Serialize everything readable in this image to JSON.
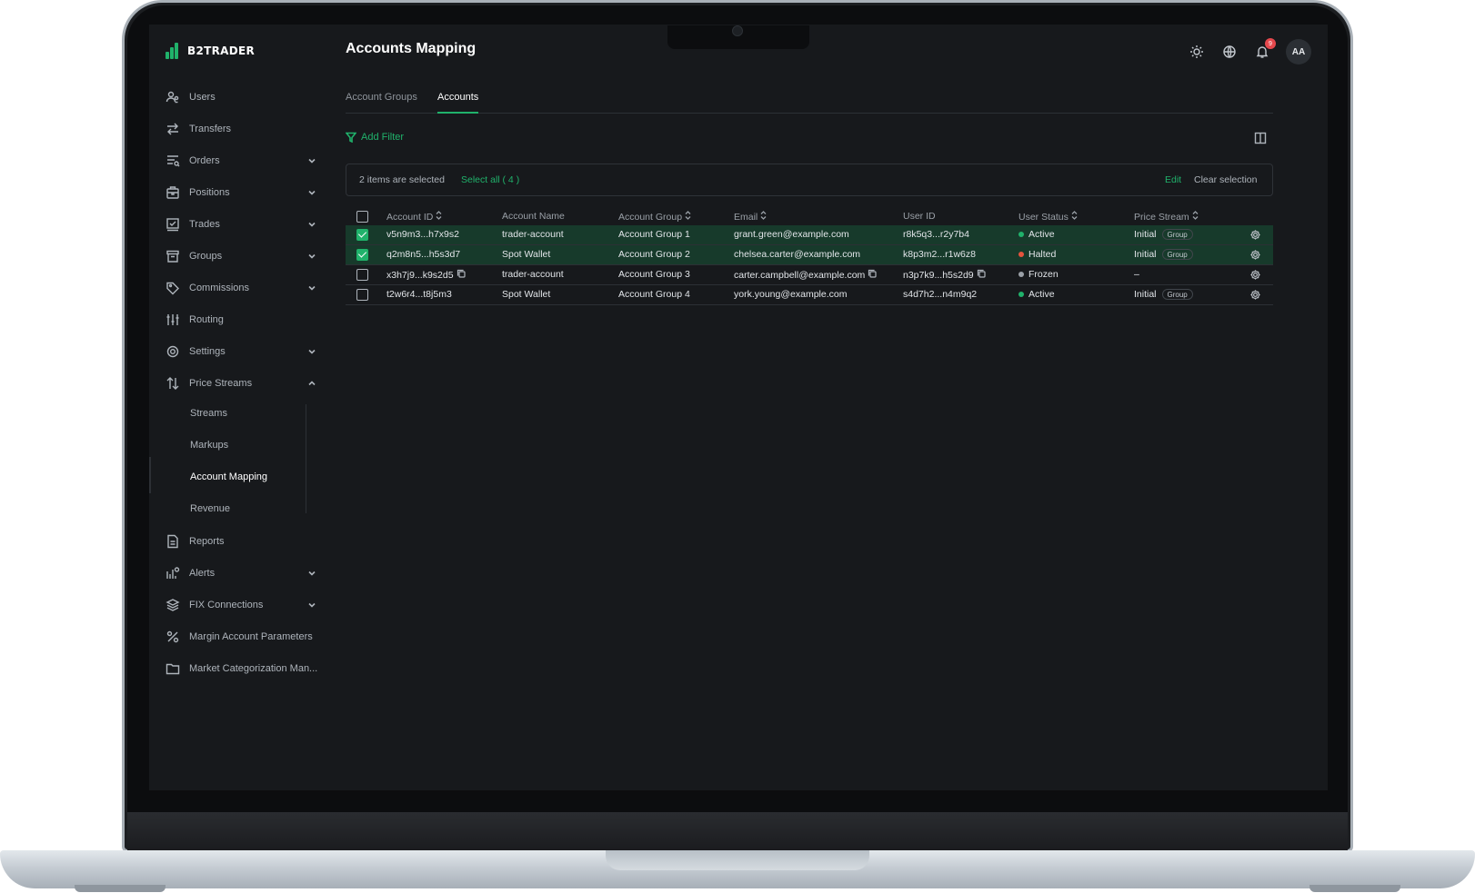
{
  "app": {
    "logo_text": "B2TRADER",
    "page_title": "Accounts Mapping"
  },
  "sidebar": {
    "items": [
      {
        "label": "Users",
        "icon": "users-icon",
        "expandable": false
      },
      {
        "label": "Transfers",
        "icon": "transfer-arrows-icon",
        "expandable": false
      },
      {
        "label": "Orders",
        "icon": "orders-list-icon",
        "expandable": true
      },
      {
        "label": "Positions",
        "icon": "briefcase-icon",
        "expandable": true
      },
      {
        "label": "Trades",
        "icon": "checkbox-chart-icon",
        "expandable": true
      },
      {
        "label": "Groups",
        "icon": "archive-box-icon",
        "expandable": true
      },
      {
        "label": "Commissions",
        "icon": "tag-icon",
        "expandable": true
      },
      {
        "label": "Routing",
        "icon": "sliders-icon",
        "expandable": false
      },
      {
        "label": "Settings",
        "icon": "gear-icon",
        "expandable": true
      },
      {
        "label": "Price Streams",
        "icon": "up-down-arrows-icon",
        "expandable": true,
        "expanded": true
      }
    ],
    "price_streams_children": [
      "Streams",
      "Markups",
      "Account Mapping",
      "Revenue"
    ],
    "active_child": "Account Mapping",
    "items_after": [
      {
        "label": "Reports",
        "icon": "document-icon",
        "expandable": false
      },
      {
        "label": "Alerts",
        "icon": "alert-chart-icon",
        "expandable": true
      },
      {
        "label": "FIX Connections",
        "icon": "layers-icon",
        "expandable": true
      },
      {
        "label": "Margin Account Parameters",
        "icon": "percent-icon",
        "expandable": false
      },
      {
        "label": "Market Categorization Man...",
        "icon": "folder-icon",
        "expandable": false
      }
    ]
  },
  "header": {
    "notification_count": "9",
    "avatar_initials": "AA"
  },
  "tabs": [
    "Account Groups",
    "Accounts"
  ],
  "active_tab": "Accounts",
  "toolbar": {
    "add_filter_label": "Add Filter"
  },
  "selection_bar": {
    "count_text": "2 items are selected",
    "select_all_text": "Select all ( 4 )",
    "edit_label": "Edit",
    "clear_label": "Clear selection"
  },
  "table": {
    "columns": [
      "Account ID",
      "Account Name",
      "Account Group",
      "Email",
      "User ID",
      "User Status",
      "Price Stream"
    ],
    "rows": [
      {
        "selected": true,
        "account_id": "v5n9m3...h7x9s2",
        "account_name": "trader-account",
        "account_group": "Account Group 1",
        "email": "grant.green@example.com",
        "user_id": "r8k5q3...r2y7b4",
        "status": "Active",
        "status_color": "#20b26b",
        "price_stream": "Initial",
        "price_stream_tag": "Group"
      },
      {
        "selected": true,
        "account_id": "q2m8n5...h5s3d7",
        "account_name": "Spot Wallet",
        "account_group": "Account Group 2",
        "email": "chelsea.carter@example.com",
        "user_id": "k8p3m2...r1w6z8",
        "status": "Halted",
        "status_color": "#e5533d",
        "price_stream": "Initial",
        "price_stream_tag": "Group"
      },
      {
        "selected": false,
        "account_id": "x3h7j9...k9s2d5",
        "account_name": "trader-account",
        "account_group": "Account Group 3",
        "email": "carter.campbell@example.com",
        "user_id": "n3p7k9...h5s2d9",
        "status": "Frozen",
        "status_color": "#9aa0a7",
        "price_stream": "–",
        "price_stream_tag": ""
      },
      {
        "selected": false,
        "account_id": "t2w6r4...t8j5m3",
        "account_name": "Spot Wallet",
        "account_group": "Account Group 4",
        "email": "york.young@example.com",
        "user_id": "s4d7h2...n4m9q2",
        "status": "Active",
        "status_color": "#20b26b",
        "price_stream": "Initial",
        "price_stream_tag": "Group"
      }
    ]
  },
  "colors": {
    "accent": "#20b26b",
    "background": "#17191c",
    "selected_row": "#173a2b",
    "badge": "#e5484d"
  }
}
